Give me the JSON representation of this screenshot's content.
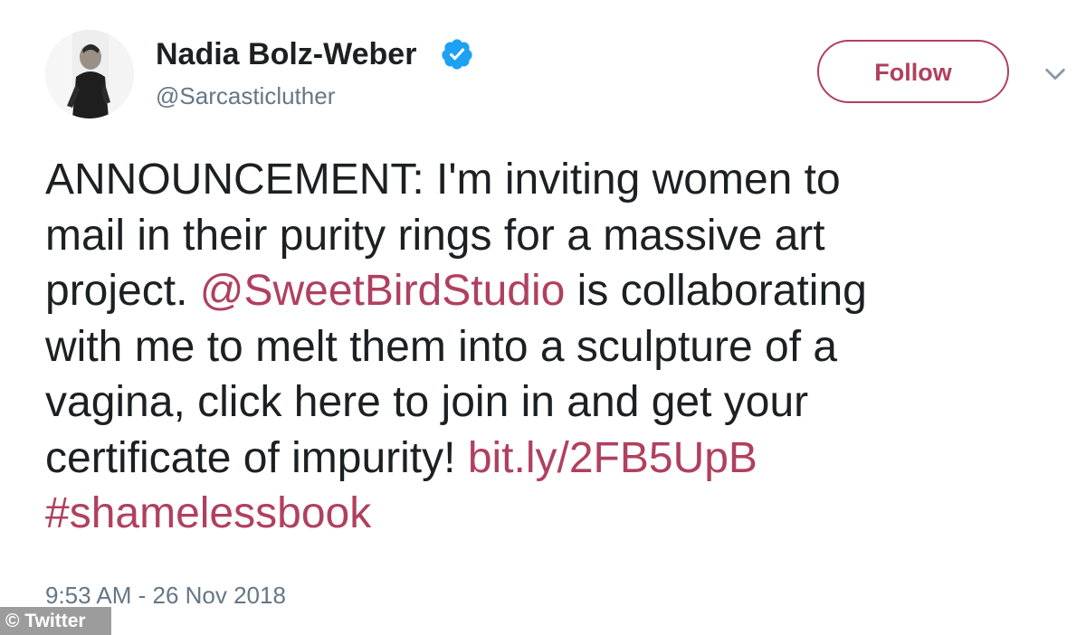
{
  "author": {
    "display_name": "Nadia Bolz-Weber",
    "handle": "@Sarcasticluther",
    "verified_icon": "verified-badge-icon",
    "avatar_icon": "profile-photo"
  },
  "header": {
    "follow_label": "Follow",
    "menu_icon": "chevron-down-icon"
  },
  "tweet": {
    "lines": [
      [
        {
          "text": "ANNOUNCEMENT: I'm inviting women to"
        }
      ],
      [
        {
          "text": "mail in their purity rings for a massive art"
        }
      ],
      [
        {
          "text": "project. "
        },
        {
          "text": "@SweetBirdStudio"
        },
        {
          "text": " is collaborating"
        }
      ],
      [
        {
          "text": "with me to melt them into a sculpture of a"
        }
      ],
      [
        {
          "text": "vagina, click here to join in and get your"
        }
      ],
      [
        {
          "text": "certificate of impurity! "
        },
        {
          "text": "bit.ly/2FB5UpB"
        }
      ],
      [
        {
          "text": "#shamelessbook"
        }
      ]
    ],
    "timestamp": "9:53 AM - 26 Nov 2018"
  },
  "watermark": {
    "text": "© Twitter"
  },
  "colors": {
    "accent": "#b0405e",
    "text": "#1c2022",
    "secondary": "#657786",
    "verified": "#1da1f2"
  }
}
